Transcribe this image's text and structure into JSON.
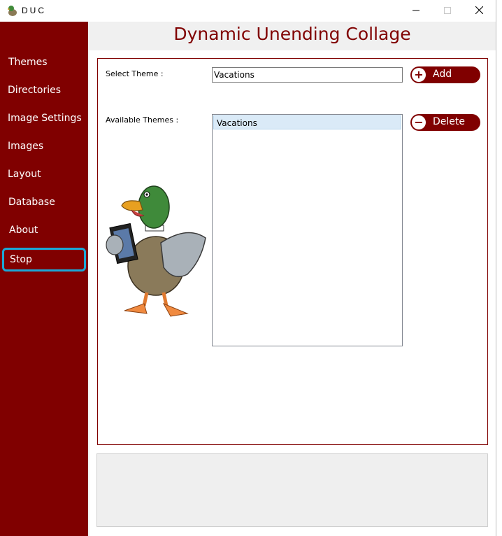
{
  "window": {
    "title": "DUC"
  },
  "header": {
    "title": "Dynamic Unending Collage"
  },
  "sidebar": {
    "items": [
      {
        "label": "Themes"
      },
      {
        "label": "Directories"
      },
      {
        "label": "Image Settings"
      },
      {
        "label": "Images"
      },
      {
        "label": "Layout"
      },
      {
        "label": "Database"
      },
      {
        "label": "About"
      },
      {
        "label": "Stop"
      }
    ]
  },
  "themes": {
    "select_label": "Select Theme :",
    "select_value": "Vacations",
    "available_label": "Available Themes :",
    "available": [
      "Vacations"
    ],
    "add_label": "Add",
    "delete_label": "Delete"
  },
  "colors": {
    "brand": "#800000",
    "focus": "#1ba8d6",
    "selected_row": "#daeaf7"
  },
  "icons": [
    "duck-logo-icon",
    "minimize-icon",
    "maximize-icon",
    "close-icon",
    "plus-icon",
    "minus-icon",
    "duck-mascot-icon"
  ]
}
